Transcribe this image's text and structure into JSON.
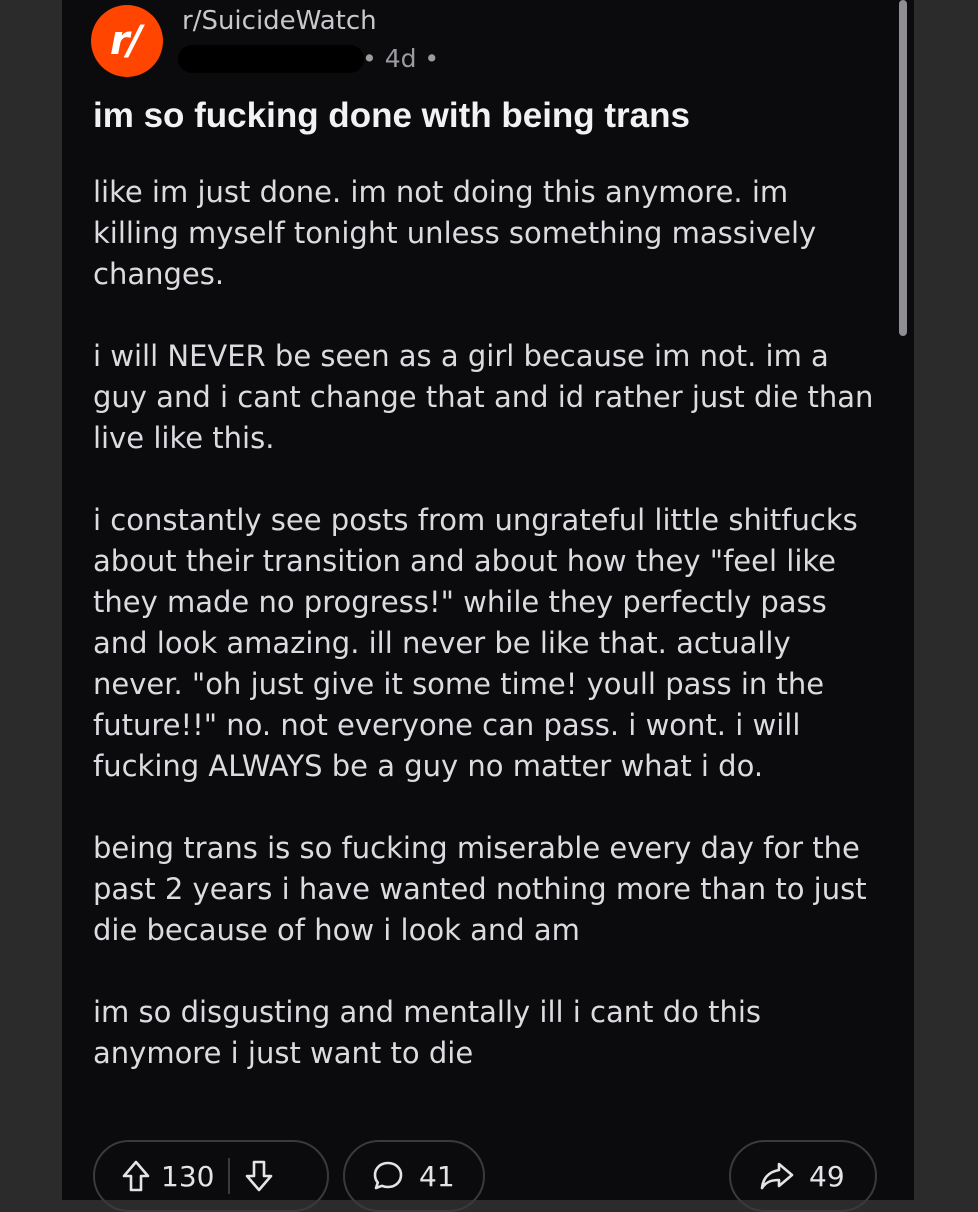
{
  "post": {
    "subreddit": "r/SuicideWatch",
    "age": "• 4d •",
    "title": "im so fucking done with being trans",
    "body": [
      "like im just done. im not doing this anymore. im killing myself tonight unless something massively changes.",
      "i will NEVER be seen as a girl because im not. im a guy and i cant change that and id rather just die than live like this.",
      "i constantly see posts from ungrateful little shitfucks about their transition and about how they \"feel like they made no progress!\" while they perfectly pass and look amazing. ill never be like that. actually never. \"oh just give it some time! youll pass in the future!!\" no. not everyone can pass. i wont. i will fucking ALWAYS be a guy no matter what i do.",
      "being trans is so fucking miserable every day for the past 2 years i have wanted nothing more than to just die because of how i look and am",
      "im so disgusting and mentally ill i cant do this anymore i just want to die"
    ]
  },
  "actions": {
    "upvotes": "130",
    "comments": "41",
    "shares": "49"
  },
  "icons": {
    "avatar": "reddit-community-icon",
    "upvote": "arrow-up-icon",
    "downvote": "arrow-down-icon",
    "comment": "speech-bubble-icon",
    "share": "share-arrow-icon"
  },
  "colors": {
    "background": "#0b0b0d",
    "avatar": "#ff4500",
    "text": "#dcdce0"
  }
}
